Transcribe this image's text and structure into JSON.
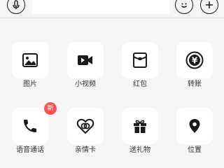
{
  "input_bar": {
    "voice_icon": "microphone-icon",
    "emoji_icon": "smiley-icon",
    "more_icon": "plus-icon",
    "text_value": ""
  },
  "panel": {
    "items": [
      {
        "label": "图片",
        "icon": "image-icon"
      },
      {
        "label": "小视频",
        "icon": "video-icon"
      },
      {
        "label": "红包",
        "icon": "red-packet-icon"
      },
      {
        "label": "转账",
        "icon": "transfer-icon"
      },
      {
        "label": "语音通话",
        "icon": "phone-icon",
        "badge": "新"
      },
      {
        "label": "亲情卡",
        "icon": "family-card-icon"
      },
      {
        "label": "送礼物",
        "icon": "gift-icon"
      },
      {
        "label": "位置",
        "icon": "location-icon"
      }
    ]
  },
  "colors": {
    "background": "#f5f5f5",
    "tile": "#ffffff",
    "icon": "#1a1a1a",
    "badge": "#fa5151"
  }
}
